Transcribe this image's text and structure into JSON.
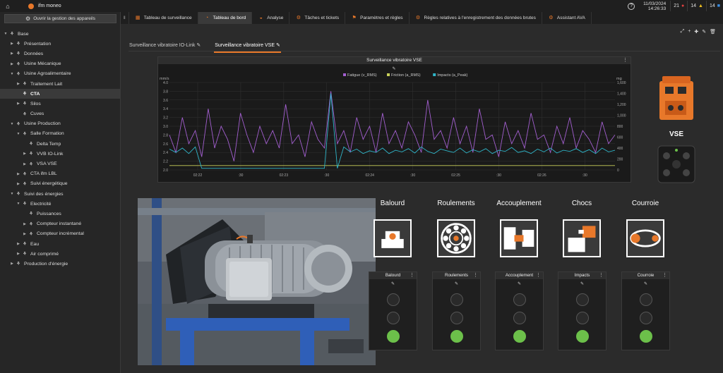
{
  "topbar": {
    "home_icon": "home-icon",
    "app_name": "ifm moneo",
    "help_symbol": "?",
    "date": "11/03/2024",
    "time": "14:26:33",
    "counters": [
      {
        "value": "21",
        "symbol": "●",
        "color": "#e04040"
      },
      {
        "value": "14",
        "symbol": "▲",
        "color": "#f0c020"
      },
      {
        "value": "14",
        "symbol": "■",
        "color": "#3a8ee6"
      }
    ]
  },
  "sidebar": {
    "manage_button": "Ouvrir la gestion des appareils",
    "tree": [
      {
        "label": "Base",
        "level": 0,
        "caret": "▼"
      },
      {
        "label": "Présentation",
        "level": 1,
        "caret": "▶"
      },
      {
        "label": "Données",
        "level": 1,
        "caret": "▶"
      },
      {
        "label": "Usine Mécanique",
        "level": 1,
        "caret": "▶"
      },
      {
        "label": "Usine Agroalimentaire",
        "level": 1,
        "caret": "▼"
      },
      {
        "label": "Traitement Lait",
        "level": 2,
        "caret": "▶"
      },
      {
        "label": "CTA",
        "level": 2,
        "caret": "",
        "selected": true
      },
      {
        "label": "Silos",
        "level": 2,
        "caret": "▶"
      },
      {
        "label": "Cuves",
        "level": 2,
        "caret": ""
      },
      {
        "label": "Usine Production",
        "level": 1,
        "caret": "▼"
      },
      {
        "label": "Salle Formation",
        "level": 2,
        "caret": "▼"
      },
      {
        "label": "Delta Temp",
        "level": 3,
        "caret": ""
      },
      {
        "label": "VVB IO-Link",
        "level": 3,
        "caret": "▶"
      },
      {
        "label": "VSA VSE",
        "level": 3,
        "caret": "▶"
      },
      {
        "label": "CTA ifm LBL",
        "level": 2,
        "caret": "▶"
      },
      {
        "label": "Suivi énergétique",
        "level": 2,
        "caret": "▶"
      },
      {
        "label": "Suivi des énergies",
        "level": 1,
        "caret": "▼"
      },
      {
        "label": "Electricité",
        "level": 2,
        "caret": "▼"
      },
      {
        "label": "Puissances",
        "level": 3,
        "caret": ""
      },
      {
        "label": "Compteur instantané",
        "level": 3,
        "caret": "▶"
      },
      {
        "label": "Compteur incrémental",
        "level": 3,
        "caret": "▶"
      },
      {
        "label": "Eau",
        "level": 2,
        "caret": "▶"
      },
      {
        "label": "Air comprimé",
        "level": 2,
        "caret": "▶"
      },
      {
        "label": "Production d'énergie",
        "level": 1,
        "caret": "▶"
      }
    ]
  },
  "tabs": [
    {
      "label": "Tableau de surveillance",
      "icon": "▦",
      "active": false
    },
    {
      "label": "Tableau de bord",
      "icon": "◔",
      "active": true
    },
    {
      "label": "Analyse",
      "icon": "◒",
      "active": false
    },
    {
      "label": "Tâches et tickets",
      "icon": "⚙",
      "active": false
    },
    {
      "label": "Paramètres et règles",
      "icon": "⚑",
      "active": false
    },
    {
      "label": "Règles relatives à l'enregistrement des données brutes",
      "icon": "⚙",
      "active": false
    },
    {
      "label": "Assistant AVA",
      "icon": "⚙",
      "active": false
    }
  ],
  "toolbar_icons": [
    "⤢",
    "+",
    "✚",
    "✎",
    "🗑"
  ],
  "subtabs": [
    {
      "label": "Surveillance vibratoire IO-Link",
      "active": false
    },
    {
      "label": "Surveillance vibratoire VSE",
      "active": true
    }
  ],
  "chart_panel": {
    "title": "Surveillance vibratoire VSE",
    "pin": "✎"
  },
  "chart_data": {
    "type": "line",
    "title": "Surveillance vibratoire VSE",
    "x_ticks": [
      "02:22",
      ":30",
      "02:23",
      ":30",
      "02:24",
      ":30",
      "02:25",
      ":30",
      "02:26",
      ":30"
    ],
    "left_axis": {
      "label": "mm/s",
      "min": 2.0,
      "max": 4.0,
      "ticks": [
        2.0,
        2.2,
        2.4,
        2.6,
        2.8,
        3.0,
        3.2,
        3.4,
        3.6,
        3.8,
        4.0
      ]
    },
    "right_axis": {
      "label": "mg",
      "min": 0,
      "max": 1600,
      "ticks": [
        0,
        200,
        400,
        600,
        800,
        1000,
        1200,
        1400,
        1600
      ]
    },
    "grid": true,
    "legend_position": "top",
    "series": [
      {
        "name": "Fatigue (v_RMS)",
        "color": "#a35fd0",
        "axis": "left",
        "values": [
          2.8,
          2.4,
          3.2,
          2.6,
          2.9,
          2.3,
          3.4,
          2.5,
          3.0,
          2.7,
          2.2,
          3.3,
          2.8,
          2.4,
          3.0,
          2.6,
          2.9,
          2.5,
          3.5,
          2.6,
          2.8,
          2.3,
          3.1,
          2.7,
          2.5,
          3.8,
          2.6,
          2.9,
          2.4,
          3.2,
          2.7,
          3.0,
          2.4,
          3.3,
          2.6,
          2.9,
          2.5,
          3.1,
          2.8,
          2.4,
          3.6,
          2.7,
          2.9,
          2.5,
          3.2,
          2.6,
          3.0,
          2.4,
          3.4,
          2.7,
          2.8,
          2.3,
          3.1,
          2.6,
          2.9,
          2.5,
          3.3,
          2.7,
          2.8,
          2.4,
          3.0,
          2.6,
          3.2,
          2.5,
          2.9,
          2.7,
          2.4,
          3.1,
          2.6,
          2.8
        ]
      },
      {
        "name": "Friction (a_RMS)",
        "color": "#c9d15a",
        "axis": "left",
        "values": [
          2.1,
          2.1,
          2.1,
          2.1,
          2.1,
          2.1,
          2.1,
          2.1,
          2.1,
          2.1,
          2.1,
          2.1,
          2.1,
          2.1,
          2.1,
          2.1,
          2.1,
          2.1,
          2.1,
          2.1,
          2.1,
          2.1,
          2.1,
          2.1,
          2.1,
          2.1,
          2.1,
          2.1,
          2.1,
          2.1,
          2.1,
          2.1,
          2.1,
          2.1,
          2.1,
          2.1,
          2.1,
          2.1,
          2.1,
          2.1,
          2.1,
          2.1,
          2.1,
          2.1,
          2.1,
          2.1,
          2.1,
          2.1,
          2.1,
          2.1,
          2.1,
          2.1,
          2.1,
          2.1,
          2.1,
          2.1,
          2.1,
          2.1,
          2.1,
          2.1,
          2.1,
          2.1,
          2.1,
          2.1,
          2.1,
          2.1,
          2.1,
          2.1,
          2.1,
          2.1
        ]
      },
      {
        "name": "Impacts (a_Peak)",
        "color": "#2fb5c8",
        "axis": "right",
        "values": [
          380,
          320,
          400,
          300,
          420,
          30,
          30,
          30,
          30,
          30,
          30,
          30,
          30,
          30,
          30,
          30,
          30,
          30,
          30,
          30,
          30,
          30,
          30,
          30,
          30,
          1400,
          30,
          420,
          330,
          380,
          300,
          350,
          320,
          400,
          300,
          360,
          330,
          390,
          310,
          420,
          340,
          300,
          380,
          350,
          320,
          400,
          310,
          370,
          330,
          390,
          300,
          360,
          340,
          410,
          320,
          350,
          300,
          380,
          330,
          400,
          310,
          360,
          340,
          390,
          320,
          370,
          300,
          400,
          330,
          360
        ]
      }
    ]
  },
  "product": {
    "name": "VSE"
  },
  "faults": [
    {
      "title": "Balourd",
      "icon": "balourd-icon",
      "indicator": "Balourd",
      "on_index": 2
    },
    {
      "title": "Roulements",
      "icon": "roulements-icon",
      "indicator": "Roulements",
      "on_index": 2
    },
    {
      "title": "Accouplement",
      "icon": "accouplement-icon",
      "indicator": "Accouplement",
      "on_index": 2
    },
    {
      "title": "Chocs",
      "icon": "chocs-icon",
      "indicator": "Impacts",
      "on_index": 2
    },
    {
      "title": "Courroie",
      "icon": "courroie-icon",
      "indicator": "Courroie",
      "on_index": 2
    }
  ],
  "colors": {
    "accent": "#e8782a",
    "ok_green": "#6cc04a",
    "background": "#2b2b2b"
  }
}
